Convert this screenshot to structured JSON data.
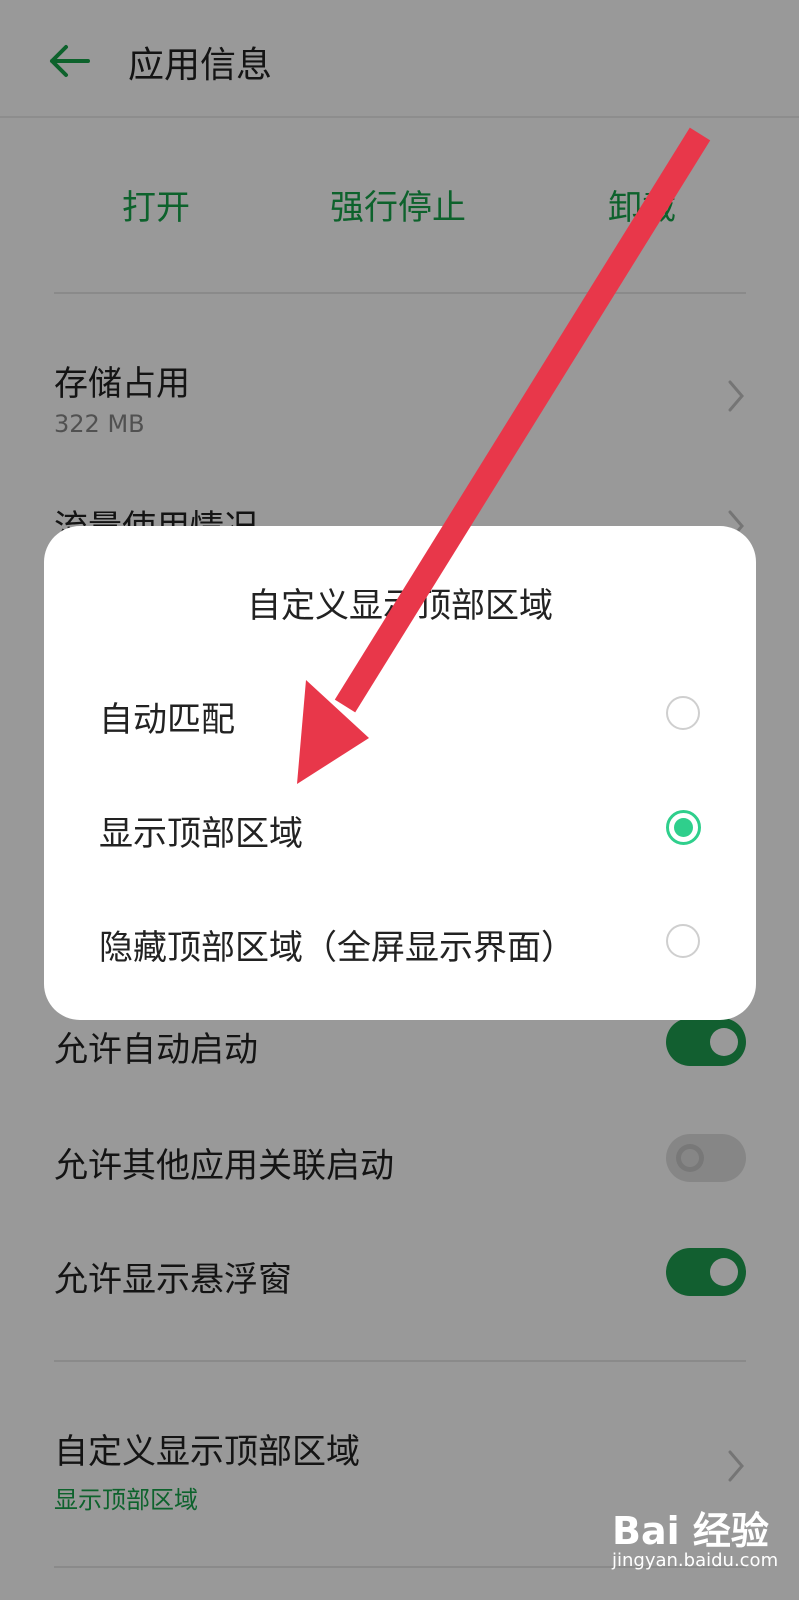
{
  "header": {
    "title": "应用信息"
  },
  "actions": {
    "open": "打开",
    "force_stop": "强行停止",
    "uninstall": "卸载"
  },
  "settings": {
    "storage": {
      "title": "存储占用",
      "value": "322 MB"
    },
    "traffic": {
      "title": "流量使用情况"
    },
    "toggles": [
      {
        "label": "允许自动启动",
        "on": true
      },
      {
        "label": "允许其他应用关联启动",
        "on": false
      },
      {
        "label": "允许显示悬浮窗",
        "on": true
      }
    ],
    "display_area": {
      "title": "自定义显示顶部区域",
      "value": "显示顶部区域"
    }
  },
  "dialog": {
    "title": "自定义显示顶部区域",
    "options": [
      {
        "label": "自动匹配",
        "checked": false
      },
      {
        "label": "显示顶部区域",
        "checked": true
      },
      {
        "label": "隐藏顶部区域（全屏显示界面）",
        "checked": false
      }
    ]
  },
  "annotation": {
    "arrow_color": "#e8374a"
  },
  "watermark": {
    "logo": "Bai 经验",
    "url": "jingyan.baidu.com"
  },
  "colors": {
    "accent": "#17a34a",
    "radio_active": "#2fcf8c"
  }
}
